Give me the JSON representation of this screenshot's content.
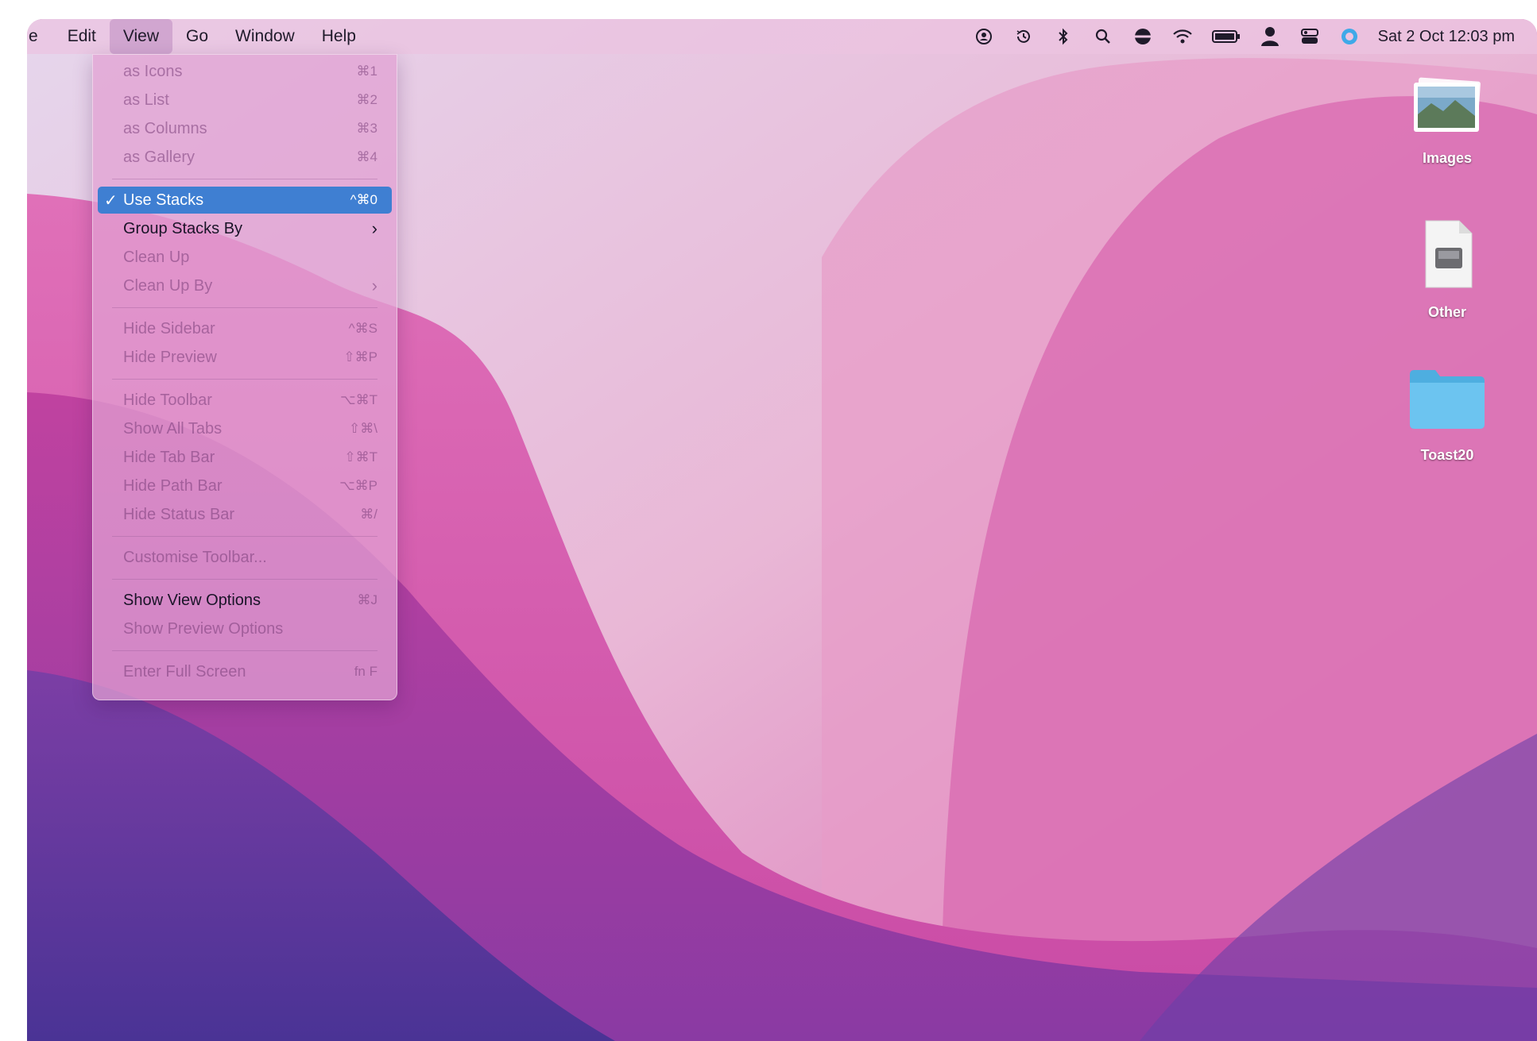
{
  "menubar": {
    "app_fragment": "e",
    "items": [
      "Edit",
      "View",
      "Go",
      "Window",
      "Help"
    ],
    "active_menu": "View",
    "status_icons": [
      "user-account-icon",
      "time-machine-icon",
      "bluetooth-icon",
      "spotlight-search-icon",
      "vpn-icon",
      "wifi-icon",
      "battery-icon",
      "user-silhouette-icon",
      "control-center-icon",
      "siri-icon"
    ],
    "clock": "Sat 2 Oct  12:03 pm"
  },
  "view_menu": {
    "items": [
      {
        "label": "as Icons",
        "shortcut": "⌘1",
        "enabled": false
      },
      {
        "label": "as List",
        "shortcut": "⌘2",
        "enabled": false
      },
      {
        "label": "as Columns",
        "shortcut": "⌘3",
        "enabled": false
      },
      {
        "label": "as Gallery",
        "shortcut": "⌘4",
        "enabled": false
      },
      {
        "label": "Use Stacks",
        "shortcut": "^⌘0",
        "enabled": true,
        "checked": true,
        "highlighted": true
      },
      {
        "label": "Group Stacks By",
        "shortcut": "",
        "enabled": true,
        "submenu": true
      },
      {
        "label": "Clean Up",
        "shortcut": "",
        "enabled": false
      },
      {
        "label": "Clean Up By",
        "shortcut": "",
        "enabled": false,
        "submenu": true
      },
      {
        "label": "Hide Sidebar",
        "shortcut": "^⌘S",
        "enabled": false
      },
      {
        "label": "Hide Preview",
        "shortcut": "⇧⌘P",
        "enabled": false
      },
      {
        "label": "Hide Toolbar",
        "shortcut": "⌥⌘T",
        "enabled": false
      },
      {
        "label": "Show All Tabs",
        "shortcut": "⇧⌘\\",
        "enabled": false
      },
      {
        "label": "Hide Tab Bar",
        "shortcut": "⇧⌘T",
        "enabled": false
      },
      {
        "label": "Hide Path Bar",
        "shortcut": "⌥⌘P",
        "enabled": false
      },
      {
        "label": "Hide Status Bar",
        "shortcut": "⌘/",
        "enabled": false
      },
      {
        "label": "Customise Toolbar...",
        "shortcut": "",
        "enabled": false
      },
      {
        "label": "Show View Options",
        "shortcut": "⌘J",
        "enabled": true
      },
      {
        "label": "Show Preview Options",
        "shortcut": "",
        "enabled": false
      },
      {
        "label": "Enter Full Screen",
        "shortcut": "fn F",
        "enabled": false
      }
    ],
    "check_mark": "✓",
    "submenu_arrow": "›"
  },
  "desktop": {
    "icons": [
      {
        "label": "Images",
        "icon": "images-stack-icon"
      },
      {
        "label": "Other",
        "icon": "document-stack-icon"
      },
      {
        "label": "Toast20",
        "icon": "folder-icon"
      }
    ]
  },
  "colors": {
    "menu_highlight": "#3f7fd2",
    "folder_blue": "#6cc4f0"
  }
}
